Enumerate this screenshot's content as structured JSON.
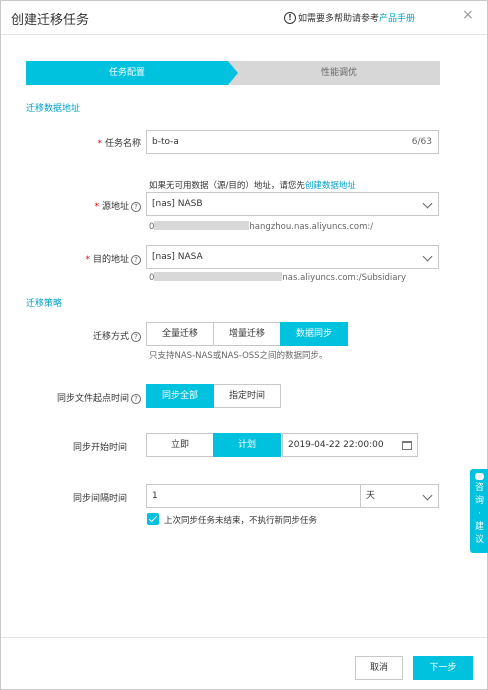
{
  "dialog": {
    "title": "创建迁移任务",
    "help_text": "如需要多帮助请参考",
    "help_link": "产品手册",
    "close_glyph": "×"
  },
  "steps": [
    {
      "label": "任务配置",
      "active": true
    },
    {
      "label": "性能调优",
      "active": false
    }
  ],
  "sections": {
    "migration_address": "迁移数据地址",
    "migration_strategy": "迁移策略"
  },
  "task_name": {
    "label": "任务名称",
    "value": "b-to-a",
    "counter": "6/63"
  },
  "source_hint": {
    "text": "如果无可用数据（源/目的）地址，请您先",
    "link": "创建数据地址"
  },
  "source": {
    "label": "源地址",
    "value": "[nas] NASB",
    "sub_prefix": "0",
    "sub_suffix": "hangzhou.nas.aliyuncs.com:/"
  },
  "destination": {
    "label": "目的地址",
    "value": "[nas] NASA",
    "sub_prefix": "0",
    "sub_suffix": "nas.aliyuncs.com:/Subsidiary"
  },
  "migration_mode": {
    "label": "迁移方式",
    "options": [
      "全量迁移",
      "增量迁移",
      "数据同步"
    ],
    "selected": "数据同步",
    "hint": "只支持NAS-NAS或NAS-OSS之间的数据同步。"
  },
  "sync_file_start": {
    "label": "同步文件起点时间",
    "options": [
      "同步全部",
      "指定时间"
    ],
    "selected": "同步全部"
  },
  "sync_start_time": {
    "label": "同步开始时间",
    "options": [
      "立即",
      "计划"
    ],
    "selected": "计划",
    "datetime": "2019-04-22 22:00:00"
  },
  "sync_interval": {
    "label": "同步间隔时间",
    "value": "1",
    "unit": "天"
  },
  "skip_checkbox": {
    "checked": true,
    "label": "上次同步任务未结束，不执行新同步任务"
  },
  "side_tab": {
    "chars": [
      "咨",
      "询",
      "·",
      "建",
      "议"
    ]
  },
  "footer": {
    "cancel": "取消",
    "next": "下一步"
  },
  "colors": {
    "accent": "#00c1de",
    "link": "#00a2ca"
  }
}
